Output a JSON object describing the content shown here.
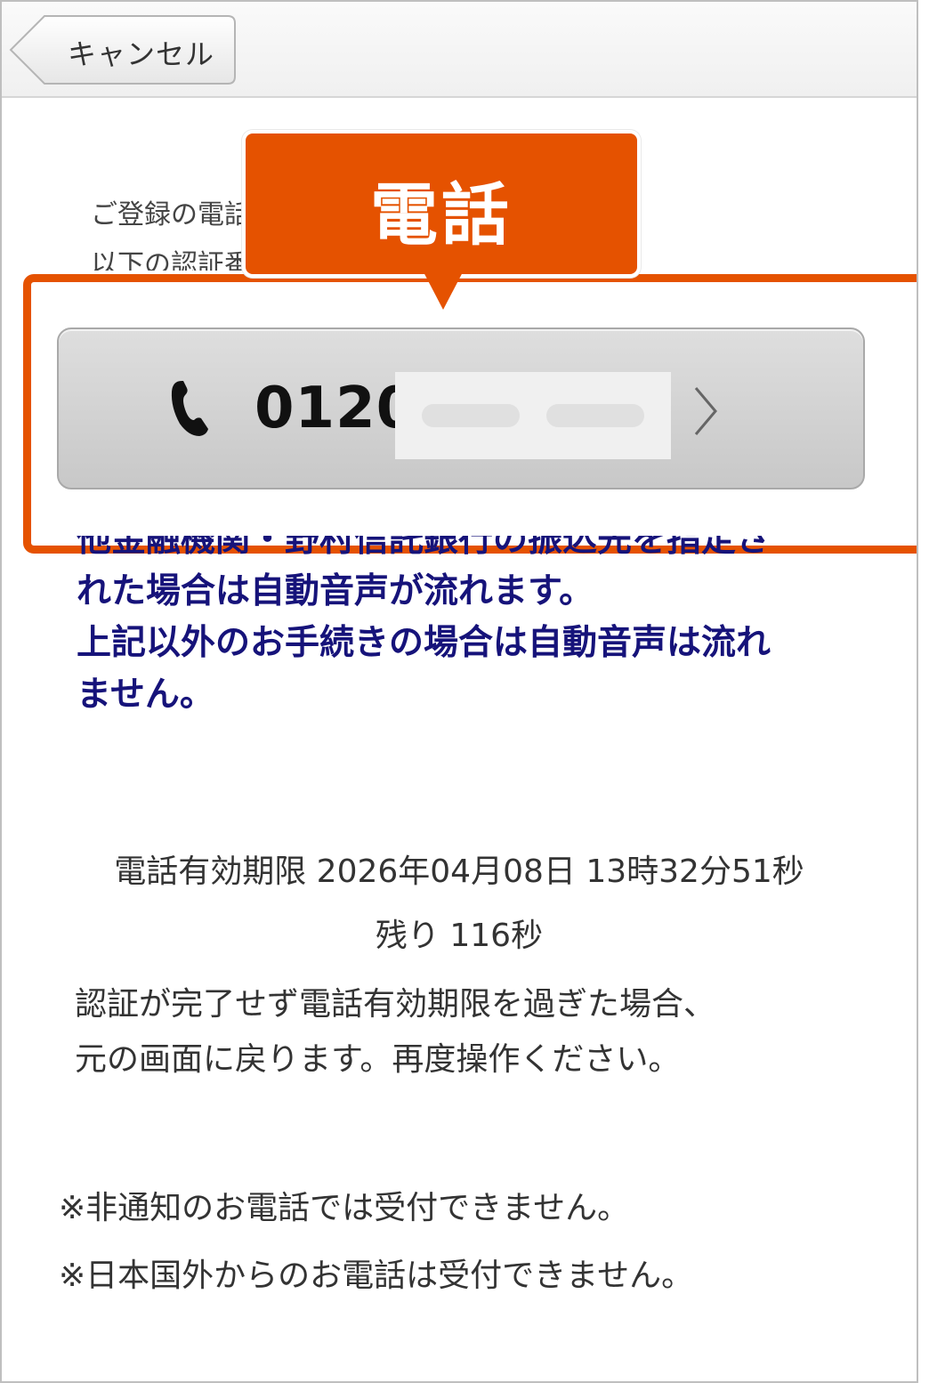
{
  "header": {
    "cancel_label": "キャンセル"
  },
  "intro": {
    "line1": "ご登録の電話番号から、",
    "line2": "以下の認証番号にお電話ください。"
  },
  "callout": {
    "label": "電話"
  },
  "phone_button": {
    "number_visible": "0120-"
  },
  "notice": {
    "line0": "他金融機関・野村信託銀行の振込先を指定さ",
    "line1": "れた場合は自動音声が流れます。",
    "line2": "上記以外のお手続きの場合は自動音声は流れ",
    "line3": "ません。"
  },
  "expiry": {
    "deadline": "電話有効期限 2026年04月08日 13時32分51秒",
    "remaining": "残り 116秒"
  },
  "warning": {
    "line1": "認証が完了せず電話有効期限を過ぎた場合、",
    "line2": "元の画面に戻ります。再度操作ください。"
  },
  "notes": [
    "※非通知のお電話では受付できません。",
    "※日本国外からのお電話は受付できません。"
  ],
  "colors": {
    "accent": "#e55200",
    "notice_text": "#16137a"
  }
}
